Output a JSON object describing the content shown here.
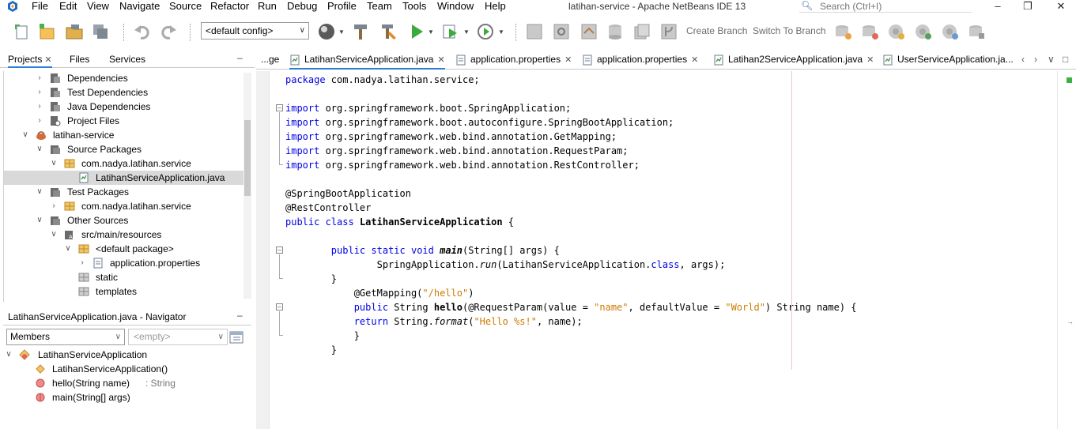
{
  "menubar": {
    "items": [
      "File",
      "Edit",
      "View",
      "Navigate",
      "Source",
      "Refactor",
      "Run",
      "Debug",
      "Profile",
      "Team",
      "Tools",
      "Window",
      "Help"
    ],
    "window_title": "latihan-service - Apache NetBeans IDE 13",
    "search_placeholder": "Search (Ctrl+I)"
  },
  "toolbar": {
    "config": "<default config>",
    "create_branch": "Create Branch",
    "switch_branch": "Switch To Branch"
  },
  "left_tabs": [
    "Projects",
    "Files",
    "Services"
  ],
  "project_tree": [
    {
      "label": "Dependencies",
      "icon": "jar-folder-icon",
      "toggle": "closed"
    },
    {
      "label": "Test Dependencies",
      "icon": "jar-folder-icon",
      "toggle": "closed"
    },
    {
      "label": "Java Dependencies",
      "icon": "jar-folder-icon",
      "toggle": "closed"
    },
    {
      "label": "Project Files",
      "icon": "project-files-icon",
      "toggle": "closed"
    },
    {
      "label": "latihan-service",
      "icon": "maven-project-icon",
      "toggle": "open"
    },
    {
      "label": "Source Packages",
      "icon": "source-folder-icon",
      "toggle": "open"
    },
    {
      "label": "com.nadya.latihan.service",
      "icon": "package-icon",
      "toggle": "open"
    },
    {
      "label": "LatihanServiceApplication.java",
      "icon": "java-file-icon",
      "toggle": "none"
    },
    {
      "label": "Test Packages",
      "icon": "source-folder-icon",
      "toggle": "open"
    },
    {
      "label": "com.nadya.latihan.service",
      "icon": "package-icon",
      "toggle": "closed"
    },
    {
      "label": "Other Sources",
      "icon": "source-folder-icon",
      "toggle": "open"
    },
    {
      "label": "src/main/resources",
      "icon": "resources-folder-icon",
      "toggle": "open"
    },
    {
      "label": "<default package>",
      "icon": "package-icon",
      "toggle": "open"
    },
    {
      "label": "application.properties",
      "icon": "properties-file-icon",
      "toggle": "closed"
    },
    {
      "label": "static",
      "icon": "grey-package-icon",
      "toggle": "none"
    },
    {
      "label": "templates",
      "icon": "grey-package-icon",
      "toggle": "none"
    }
  ],
  "navigator": {
    "title": "LatihanServiceApplication.java - Navigator",
    "filter": "Members",
    "empty": "<empty>",
    "class_name": "LatihanServiceApplication",
    "members": [
      {
        "name": "LatihanServiceApplication()",
        "type": "",
        "icon": "constructor-icon"
      },
      {
        "name": "hello(String name)",
        "type": " : String",
        "icon": "method-icon"
      },
      {
        "name": "main(String[] args)",
        "type": "",
        "icon": "static-method-icon"
      }
    ]
  },
  "editor_tabs": [
    {
      "label": "...ge",
      "icon": "",
      "closable": false
    },
    {
      "label": "LatihanServiceApplication.java",
      "icon": "java-file-icon",
      "closable": true
    },
    {
      "label": "application.properties",
      "icon": "properties-file-icon",
      "closable": true
    },
    {
      "label": "application.properties",
      "icon": "properties-file-icon",
      "closable": true
    },
    {
      "label": "Latihan2ServiceApplication.java",
      "icon": "java-file-icon",
      "closable": true
    },
    {
      "label": "UserServiceApplication.ja...",
      "icon": "java-file-icon",
      "closable": false
    }
  ],
  "code": [
    [
      [
        "kw",
        "package"
      ],
      [
        "t",
        " com.nadya.latihan.service;"
      ]
    ],
    [],
    [
      [
        "kw",
        "import"
      ],
      [
        "t",
        " org.springframework.boot.SpringApplication;"
      ]
    ],
    [
      [
        "kw",
        "import"
      ],
      [
        "t",
        " org.springframework.boot.autoconfigure.SpringBootApplication;"
      ]
    ],
    [
      [
        "kw",
        "import"
      ],
      [
        "t",
        " org.springframework.web.bind.annotation.GetMapping;"
      ]
    ],
    [
      [
        "kw",
        "import"
      ],
      [
        "t",
        " org.springframework.web.bind.annotation.RequestParam;"
      ]
    ],
    [
      [
        "kw",
        "import"
      ],
      [
        "t",
        " org.springframework.web.bind.annotation.RestController;"
      ]
    ],
    [],
    [
      [
        "t",
        "@SpringBootApplication"
      ]
    ],
    [
      [
        "t",
        "@RestController"
      ]
    ],
    [
      [
        "kw",
        "public"
      ],
      [
        "t",
        " "
      ],
      [
        "kw",
        "class"
      ],
      [
        "b",
        " LatihanServiceApplication"
      ],
      [
        "t",
        " {"
      ]
    ],
    [],
    [
      [
        "t",
        "        "
      ],
      [
        "kw",
        "public"
      ],
      [
        "t",
        " "
      ],
      [
        "kw",
        "static"
      ],
      [
        "t",
        " "
      ],
      [
        "kw",
        "void"
      ],
      [
        "t",
        " "
      ],
      [
        "bi",
        "main"
      ],
      [
        "t",
        "(String[] args) {"
      ]
    ],
    [
      [
        "t",
        "                SpringApplication."
      ],
      [
        "i",
        "run"
      ],
      [
        "t",
        "(LatihanServiceApplication."
      ],
      [
        "kw",
        "class"
      ],
      [
        "t",
        ", args);"
      ]
    ],
    [
      [
        "t",
        "        }"
      ]
    ],
    [
      [
        "t",
        "            @GetMapping("
      ],
      [
        "str",
        "\"/hello\""
      ],
      [
        "t",
        ")"
      ]
    ],
    [
      [
        "t",
        "            "
      ],
      [
        "kw",
        "public"
      ],
      [
        "t",
        " String "
      ],
      [
        "b",
        "hello"
      ],
      [
        "t",
        "(@RequestParam(value = "
      ],
      [
        "str",
        "\"name\""
      ],
      [
        "t",
        ", defaultValue = "
      ],
      [
        "str",
        "\"World\""
      ],
      [
        "t",
        ") String name) {"
      ]
    ],
    [
      [
        "t",
        "            "
      ],
      [
        "kw",
        "return"
      ],
      [
        "t",
        " String."
      ],
      [
        "i",
        "format"
      ],
      [
        "t",
        "("
      ],
      [
        "str",
        "\"Hello %s!\""
      ],
      [
        "t",
        ", name);"
      ]
    ],
    [
      [
        "t",
        "            }"
      ]
    ],
    [
      [
        "t",
        "        }"
      ]
    ],
    []
  ]
}
